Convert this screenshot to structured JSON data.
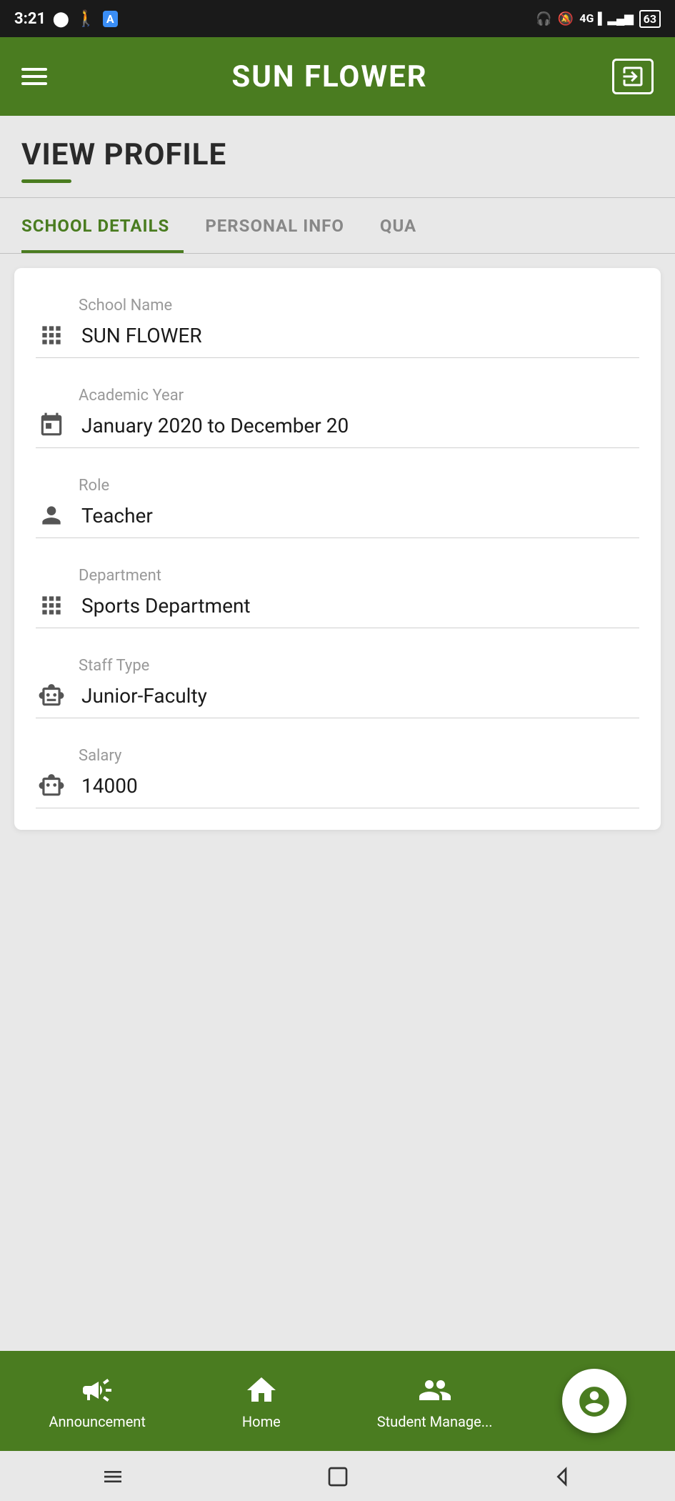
{
  "statusBar": {
    "time": "3:21",
    "rightIcons": [
      "headphone",
      "bell-off",
      "signal",
      "battery"
    ]
  },
  "appBar": {
    "title": "SUN FLOWER",
    "menuIcon": "menu",
    "logoutIcon": "logout"
  },
  "page": {
    "title": "VIEW PROFILE",
    "underline": true
  },
  "tabs": [
    {
      "label": "SCHOOL DETAILS",
      "active": true
    },
    {
      "label": "PERSONAL INFO",
      "active": false
    },
    {
      "label": "QUA",
      "active": false,
      "truncated": true
    }
  ],
  "formFields": [
    {
      "label": "School Name",
      "value": "SUN FLOWER",
      "iconType": "grid"
    },
    {
      "label": "Academic Year",
      "value": "January 2020   to   December 20",
      "iconType": "calendar"
    },
    {
      "label": "Role",
      "value": "Teacher",
      "iconType": "person"
    },
    {
      "label": "Department",
      "value": "Sports Department",
      "iconType": "building"
    },
    {
      "label": "Staff Type",
      "value": "Junior-Faculty",
      "iconType": "badge"
    },
    {
      "label": "Salary",
      "value": "14000",
      "iconType": "money"
    }
  ],
  "bottomNav": {
    "items": [
      {
        "label": "Announcement",
        "iconType": "announcement"
      },
      {
        "label": "Home",
        "iconType": "home"
      },
      {
        "label": "Student Manage...",
        "iconType": "students"
      }
    ],
    "fab": {
      "iconType": "user-circle"
    }
  },
  "androidNav": {
    "buttons": [
      "menu",
      "square",
      "triangle"
    ]
  }
}
